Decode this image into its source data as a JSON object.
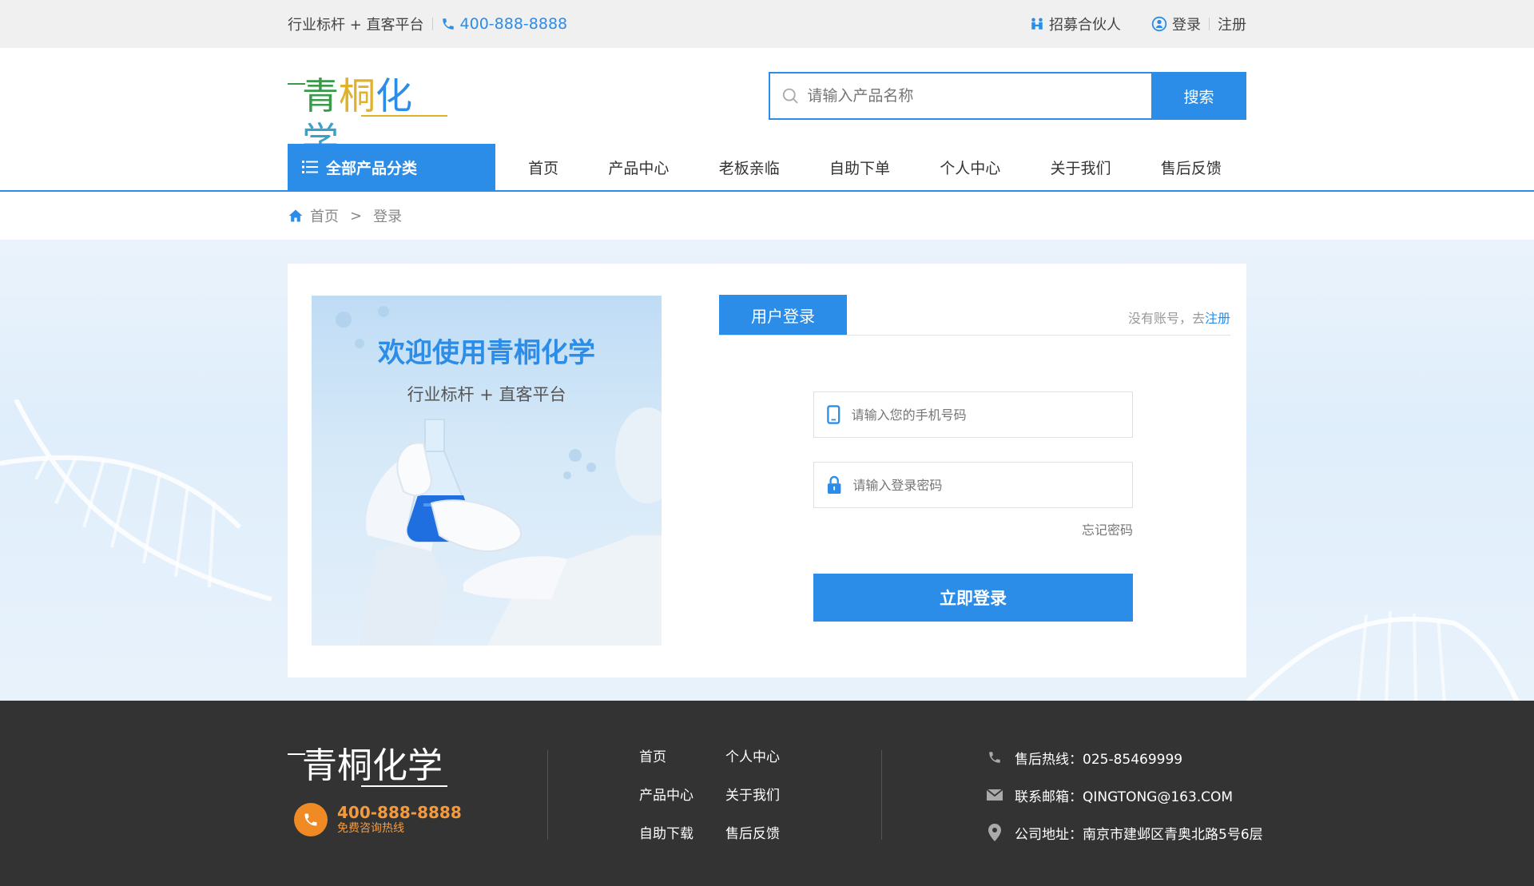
{
  "topbar": {
    "slogan": "行业标杆 + 直客平台",
    "phone": "400-888-8888",
    "partner": "招募合伙人",
    "login": "登录",
    "register": "注册"
  },
  "header": {
    "logo": {
      "c1": "青",
      "c2": "桐",
      "c3": "化",
      "c4": "学"
    },
    "search_placeholder": "请输入产品名称",
    "search_button": "搜索"
  },
  "nav": {
    "category": "全部产品分类",
    "items": [
      "首页",
      "产品中心",
      "老板亲临",
      "自助下单",
      "个人中心",
      "关于我们",
      "售后反馈"
    ]
  },
  "breadcrumb": {
    "home": "首页",
    "separator": ">",
    "current": "登录"
  },
  "banner": {
    "title": "欢迎使用青桐化学",
    "subtitle": "行业标杆 + 直客平台"
  },
  "login": {
    "tab": "用户登录",
    "no_account": "没有账号，去",
    "register_link": "注册",
    "phone_placeholder": "请输入您的手机号码",
    "password_placeholder": "请输入登录密码",
    "forgot": "忘记密码",
    "submit": "立即登录"
  },
  "footer": {
    "logo": "青桐化学",
    "phone": "400-888-8888",
    "phone_label": "免费咨询热线",
    "links": [
      "首页",
      "个人中心",
      "产品中心",
      "关于我们",
      "自助下载",
      "售后反馈"
    ],
    "hotline": "售后热线：025-85469999",
    "email": "联系邮箱：QINGTONG@163.COM",
    "address": "公司地址：南京市建邺区青奥北路5号6层"
  },
  "colors": {
    "primary": "#2b8de8",
    "footer_bg": "#333333",
    "accent_orange": "#f08a24"
  }
}
